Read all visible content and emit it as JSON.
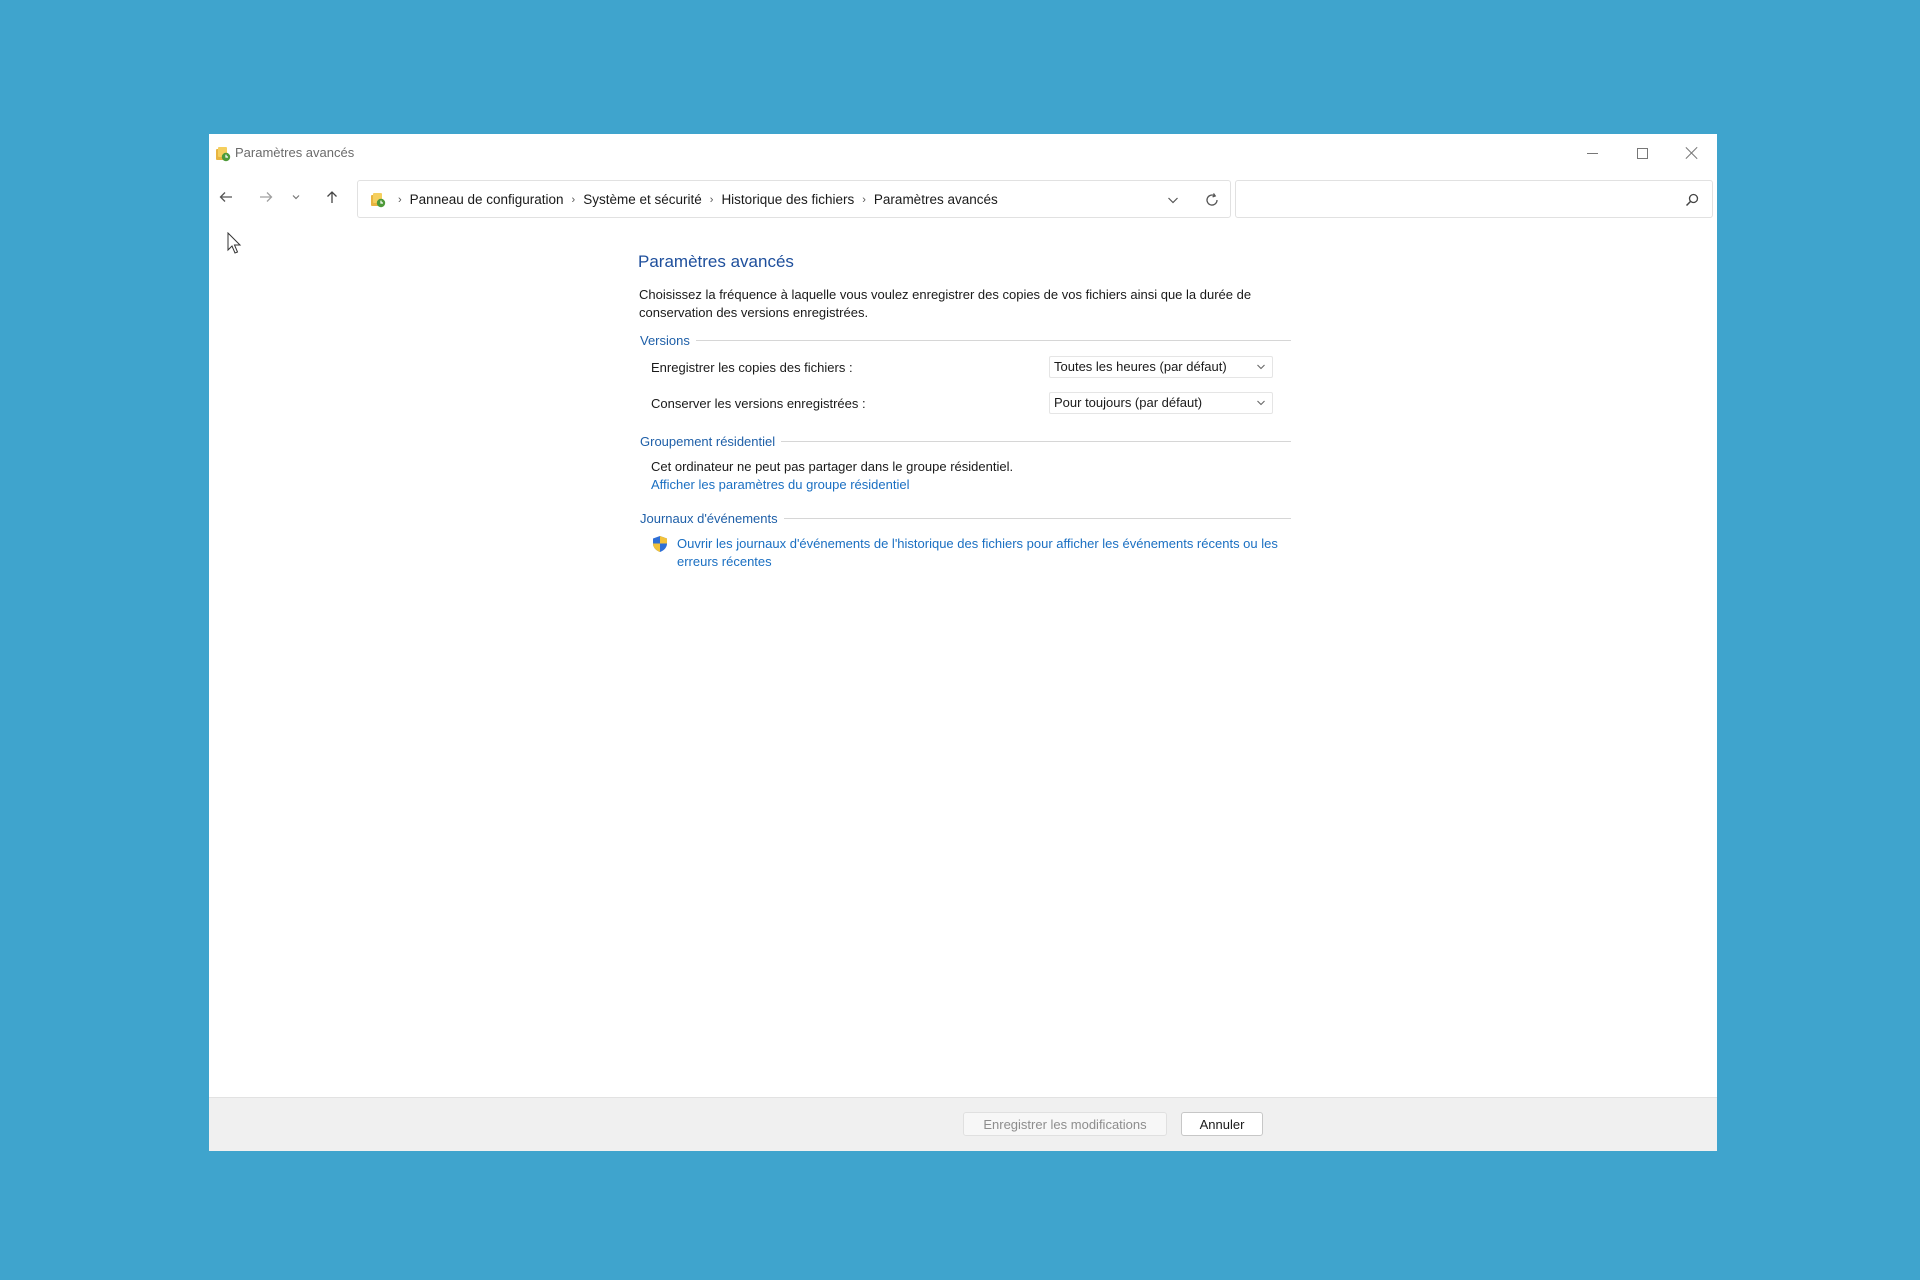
{
  "window": {
    "title": "Paramètres avancés"
  },
  "nav": {
    "breadcrumbs": [
      "Panneau de configuration",
      "Système et sécurité",
      "Historique des fichiers",
      "Paramètres avancés"
    ],
    "search": {
      "value": "",
      "placeholder": ""
    }
  },
  "main": {
    "title": "Paramètres avancés",
    "description": "Choisissez la fréquence à laquelle vous voulez enregistrer des copies de vos fichiers ainsi que la durée de conservation des versions enregistrées.",
    "versions": {
      "header": "Versions",
      "save_copies_label": "Enregistrer les copies des fichiers :",
      "save_copies_value": "Toutes les heures (par défaut)",
      "keep_versions_label": "Conserver les versions enregistrées :",
      "keep_versions_value": "Pour toujours (par défaut)"
    },
    "homegroup": {
      "header": "Groupement résidentiel",
      "text": "Cet ordinateur ne peut pas partager dans le groupe résidentiel.",
      "link": "Afficher les paramètres du groupe résidentiel"
    },
    "event_logs": {
      "header": "Journaux d'événements",
      "link": "Ouvrir les journaux d'événements de l'historique des fichiers pour afficher les événements récents ou les erreurs récentes"
    }
  },
  "footer": {
    "save_label": "Enregistrer les modifications",
    "cancel_label": "Annuler"
  },
  "icons": {
    "app": "file-history-icon",
    "back": "back-arrow-icon",
    "forward": "forward-arrow-icon",
    "recent": "chevron-down-icon",
    "up": "up-arrow-icon",
    "refresh": "refresh-icon",
    "search": "search-icon",
    "shield": "uac-shield-icon"
  },
  "colors": {
    "desktop": "#3fa4cd",
    "heading": "#1e4f9c",
    "link": "#1a6fc2"
  }
}
